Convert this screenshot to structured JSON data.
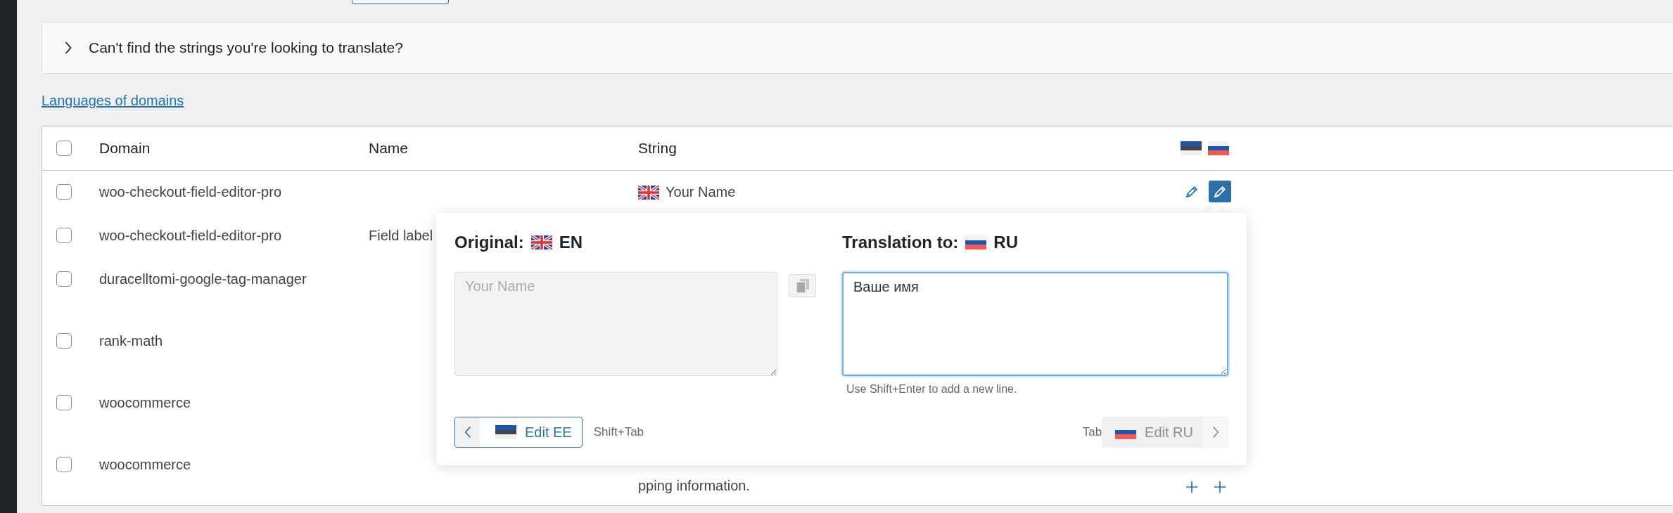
{
  "top_button": {
    "kind": "partial"
  },
  "collapse": {
    "label": "Can't find the strings you're looking to translate?",
    "expanded": false
  },
  "link": "Languages of domains",
  "table": {
    "select_all_checked": false,
    "columns": [
      "Domain",
      "Name",
      "String"
    ],
    "language_flags": [
      {
        "kind": "ee"
      },
      {
        "kind": "ru"
      }
    ],
    "rows": [
      {
        "checked": false,
        "domain": "woo-checkout-field-editor-pro",
        "string": "Your Name",
        "string_flag": {
          "kind": "gb"
        },
        "actions": [
          {
            "kind": "edit",
            "selected": false
          },
          {
            "kind": "edit",
            "selected": true
          }
        ]
      },
      {
        "checked": false,
        "domain": "woo-checkout-field-editor-pro",
        "name": "Field label"
      },
      {
        "checked": false,
        "domain": "duracelltomi-google-tag-manager"
      },
      {
        "checked": false,
        "domain": "rank-math"
      },
      {
        "checked": false,
        "domain": "woocommerce"
      },
      {
        "checked": false,
        "domain": "woocommerce",
        "string": "pping information.",
        "actions": [
          {
            "kind": "add",
            "selected": false
          },
          {
            "kind": "add",
            "selected": false
          }
        ]
      }
    ]
  },
  "popup": {
    "original": {
      "label": "Original:",
      "flag": {
        "kind": "gb"
      },
      "lang": "EN",
      "value": "Your Name",
      "disabled": true
    },
    "translation": {
      "label": "Translation to:",
      "flag": {
        "kind": "ru"
      },
      "lang": "RU",
      "value": "Ваше имя",
      "focused": true,
      "hint": "Use Shift+Enter to add a new line."
    },
    "prev": {
      "label": "Edit EE",
      "flag": {
        "kind": "ee"
      },
      "disabled": false,
      "shortcut": "Shift+Tab"
    },
    "next": {
      "label": "Edit RU",
      "flag": {
        "kind": "ru"
      },
      "disabled": true,
      "shortcut": "Tab"
    }
  }
}
